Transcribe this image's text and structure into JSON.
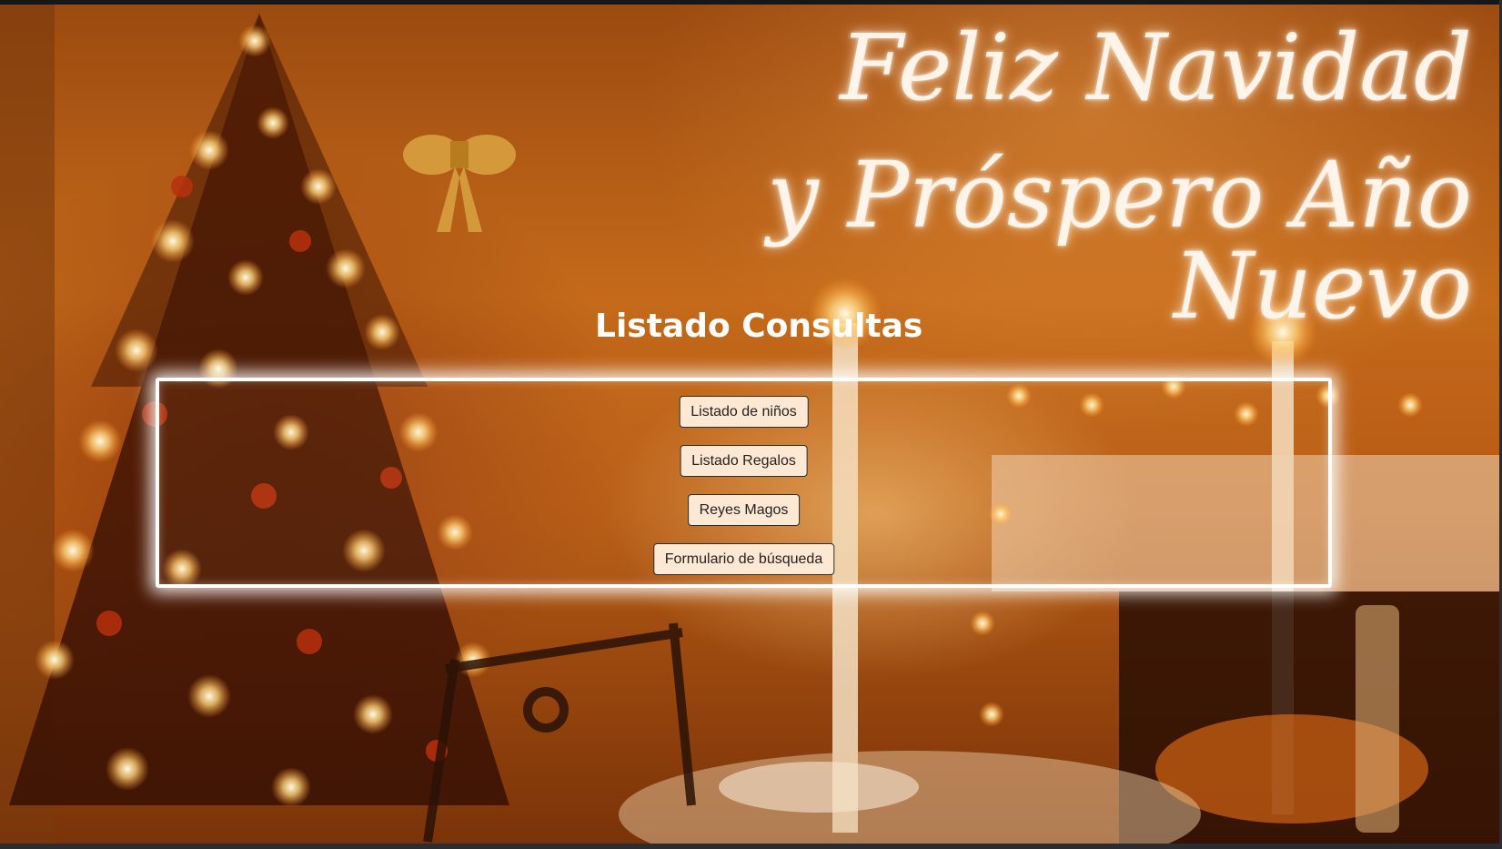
{
  "background": {
    "greeting_line1": "Feliz Navidad",
    "greeting_line2": "y Próspero Año Nuevo"
  },
  "page": {
    "title": "Listado Consultas"
  },
  "menu": {
    "buttons": [
      {
        "label": "Listado de niños"
      },
      {
        "label": "Listado Regalos"
      },
      {
        "label": "Reyes Magos"
      },
      {
        "label": "Formulario de búsqueda"
      }
    ]
  },
  "colors": {
    "button_bg": "#fde8d3",
    "button_border": "#2d2d2d",
    "panel_border": "#ffffff",
    "title_color": "#ffffff"
  }
}
